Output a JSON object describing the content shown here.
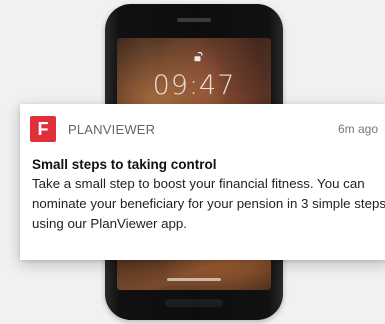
{
  "lockscreen": {
    "time": "09:47"
  },
  "notification": {
    "app_icon_letter": "F",
    "app_name": "PLANVIEWER",
    "age": "6m ago",
    "title": "Small steps to taking control",
    "body": "Take a small step to boost your financial fitness. You can nominate your beneficiary for your pension in 3 simple steps using our PlanViewer app."
  },
  "colors": {
    "app_icon": "#e0303a",
    "card": "#ffffff",
    "background": "#f1f1f1"
  },
  "icons": [
    "lock-icon"
  ]
}
